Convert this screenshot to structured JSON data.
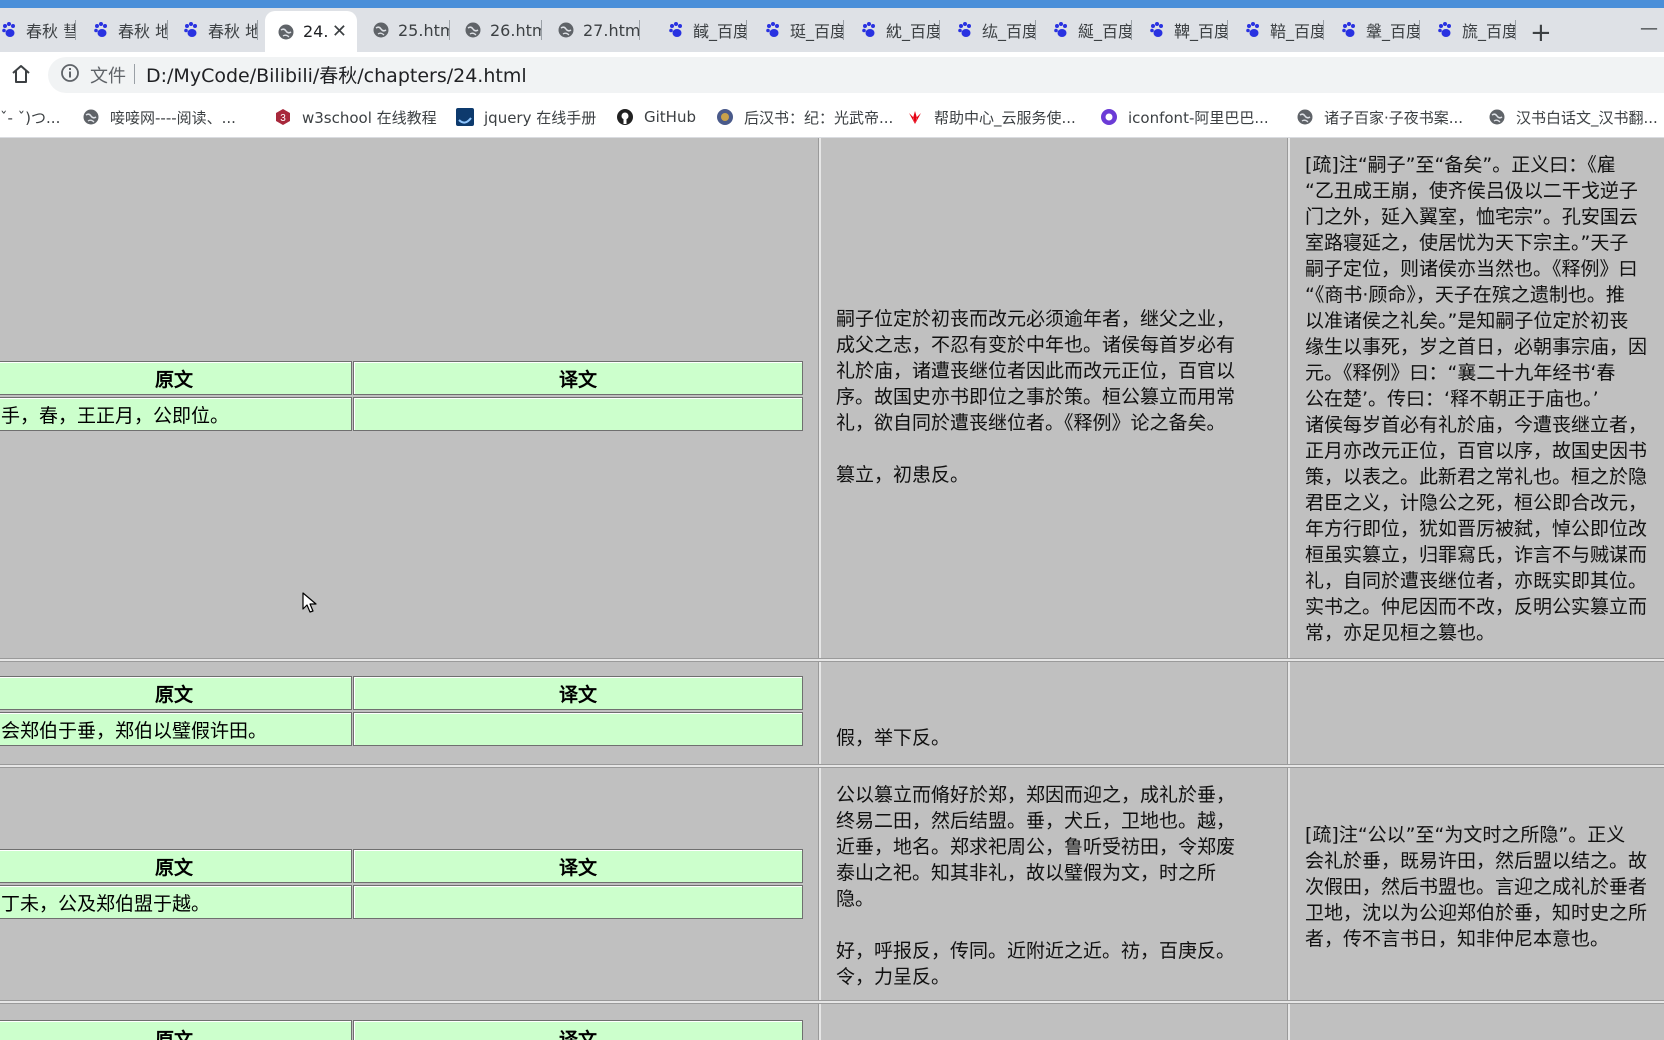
{
  "browser": {
    "tabs": [
      {
        "label": "春秋 彗",
        "icon": "baidu-paw-icon"
      },
      {
        "label": "春秋 地",
        "icon": "baidu-paw-icon"
      },
      {
        "label": "春秋 地",
        "icon": "baidu-paw-icon"
      },
      {
        "label": "24.",
        "icon": "globe-icon",
        "active": true
      },
      {
        "label": "25.htm",
        "icon": "globe-icon"
      },
      {
        "label": "26.htm",
        "icon": "globe-icon"
      },
      {
        "label": "27.htm",
        "icon": "globe-icon"
      },
      {
        "label": "馘_百度",
        "icon": "baidu-paw-icon"
      },
      {
        "label": "珽_百度",
        "icon": "baidu-paw-icon"
      },
      {
        "label": "紞_百度",
        "icon": "baidu-paw-icon"
      },
      {
        "label": "纮_百度",
        "icon": "baidu-paw-icon"
      },
      {
        "label": "綖_百度",
        "icon": "baidu-paw-icon"
      },
      {
        "label": "鞞_百度",
        "icon": "baidu-paw-icon"
      },
      {
        "label": "鞛_百度",
        "icon": "baidu-paw-icon"
      },
      {
        "label": "鞶_百度",
        "icon": "baidu-paw-icon"
      },
      {
        "label": "旒_百度",
        "icon": "baidu-paw-icon"
      }
    ],
    "new_tab": "+",
    "minimize": "—",
    "close_tab": "✕",
    "scheme_label": "文件",
    "url": "D:/MyCode/Bilibili/春秋/chapters/24.html",
    "bookmarks": [
      {
        "label": "ˇ- ˇ)つ...",
        "icon": "none"
      },
      {
        "label": "唼唼网----阅读、...",
        "icon": "globe-icon"
      },
      {
        "label": "w3school 在线教程",
        "icon": "w3school-icon"
      },
      {
        "label": "jquery 在线手册",
        "icon": "jquery-icon"
      },
      {
        "label": "GitHub",
        "icon": "github-icon"
      },
      {
        "label": "后汉书：纪：光武帝...",
        "icon": "ctext-icon"
      },
      {
        "label": "帮助中心_云服务使...",
        "icon": "huawei-icon"
      },
      {
        "label": "iconfont-阿里巴巴...",
        "icon": "iconfont-icon"
      },
      {
        "label": "诸子百家·子夜书案...",
        "icon": "globe-icon"
      },
      {
        "label": "汉书白话文_汉书翻...",
        "icon": "globe-icon"
      }
    ],
    "colors": {
      "accent": "#4a8fd9",
      "page_bg": "#c0c0c0",
      "table_bg": "#ccffcc"
    }
  },
  "page": {
    "head_original": "原文",
    "head_translation": "译文",
    "rows": [
      {
        "original": "元年，春，王正月，公即位。",
        "original_visible": "手，春，王正月，公即位。",
        "translation": "",
        "commentary": [
          "嗣子位定於初丧而改元必须逾年者，继父之业，",
          "成父之志，不忍有变於中年也。诸侯每首岁必有",
          "礼於庙，诸遭丧继位者因此而改元正位，百官以",
          "序。故国史亦书即位之事於策。桓公篡立而用常",
          "礼，欲自同於遭丧继位者。《释例》论之备矣。",
          "",
          "篡立，初患反。"
        ],
        "shu": [
          "[疏]注“嗣子”至“备矣”。正义曰：《雇",
          "“乙丑成王崩，使齐侯吕伋以二干戈逆子",
          "门之外，延入翼室，恤宅宗”。孔安国云",
          "室路寝延之，使居忧为天下宗主。”天子",
          "嗣子定位，则诸侯亦当然也。《释例》曰",
          "“《商书·顾命》，天子在殡之遗制也。推",
          "以准诸侯之礼矣。”是知嗣子位定於初丧",
          "缘生以事死，岁之首日，必朝事宗庙，因",
          "元。《释例》曰：“襄二十九年经书‘春",
          "公在楚’。传曰：‘释不朝正于庙也。’",
          "诸侯每岁首必有礼於庙，今遭丧继立者，",
          "正月亦改元正位，百官以序，故国史因书",
          "策，以表之。此新君之常礼也。桓之於隐",
          "君臣之义，计隐公之死，桓公即合改元，",
          "年方行即位，犹如晋厉被弑，悼公即位改",
          "桓虽实篡立，归罪寫氏，诈言不与贼谋而",
          "礼，自同於遭丧继位者，亦既实即其位。",
          "实书之。仲尼因而不改，反明公实篡立而",
          "常，亦足见桓之篡也。"
        ]
      },
      {
        "original_visible": "会郑伯于垂，郑伯以璧假许田。",
        "translation": "",
        "commentary": [
          "假，举下反。"
        ],
        "shu": []
      },
      {
        "original_visible": "丁未，公及郑伯盟于越。",
        "translation": "",
        "commentary": [
          "公以篡立而脩好於郑，郑因而迎之，成礼於垂，",
          "终易二田，然后结盟。垂，犬丘，卫地也。越，",
          "近垂，地名。郑求祀周公，鲁听受祊田，令郑废",
          "泰山之祀。知其非礼，故以璧假为文，时之所",
          "隐。",
          "",
          "好，呼报反，传同。近附近之近。祊，百庚反。",
          "令，力呈反。"
        ],
        "shu": [
          "[疏]注“公以”至“为文时之所隐”。正义",
          "会礼於垂，既易许田，然后盟以结之。故",
          "次假田，然后书盟也。言迎之成礼於垂者",
          "卫地，沈以为公迎郑伯於垂，知时史之所",
          "者，传不言书日，知非仲尼本意也。"
        ]
      }
    ]
  }
}
